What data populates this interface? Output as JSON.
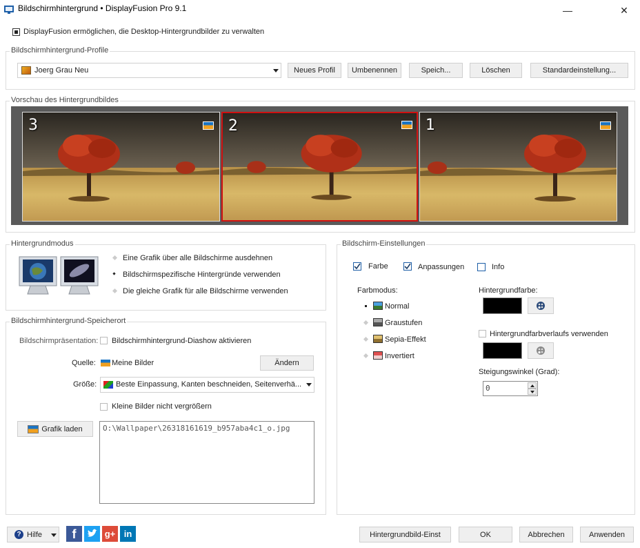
{
  "window": {
    "title": "Bildschirmhintergrund • DisplayFusion Pro 9.1",
    "minimize": "—",
    "close": "✕"
  },
  "enable": {
    "label": "DisplayFusion ermöglichen, die Desktop-Hintergrundbilder zu verwalten",
    "checked": true
  },
  "profiles": {
    "group_label": "Bildschirmhintergrund-Profile",
    "selected": "Joerg Grau Neu",
    "buttons": {
      "new": "Neues Profil",
      "rename": "Umbenennen",
      "save": "Speich...",
      "delete": "Löschen",
      "default": "Standardeinstellung..."
    }
  },
  "preview": {
    "group_label": "Vorschau des Hintergrundbildes",
    "monitors": [
      {
        "number": "3",
        "selected": false
      },
      {
        "number": "2",
        "selected": true
      },
      {
        "number": "1",
        "selected": false
      }
    ]
  },
  "mode": {
    "group_label": "Hintergrundmodus",
    "options": [
      "Eine Grafik über alle Bildschirme ausdehnen",
      "Bildschirmspezifische Hintergründe verwenden",
      "Die gleiche Grafik für alle Bildschirme verwenden"
    ],
    "selected_index": 1
  },
  "location": {
    "group_label": "Bildschirmhintergrund-Speicherort",
    "slideshow_label": "Bildschirmpräsentation:",
    "slideshow_check": "Bildschirmhintergrund-Diashow aktivieren",
    "source_label": "Quelle:",
    "source_value": "Meine Bilder",
    "change_button": "Ändern",
    "size_label": "Größe:",
    "size_value": "Beste Einpassung, Kanten beschneiden, Seitenverhä...",
    "no_enlarge": "Kleine Bilder nicht vergrößern",
    "load_button": "Grafik laden",
    "path": "O:\\Wallpaper\\26318161619_b957aba4c1_o.jpg"
  },
  "screen_settings": {
    "group_label": "Bildschirm-Einstellungen",
    "checks": {
      "color": "Farbe",
      "adjust": "Anpassungen",
      "info": "Info"
    },
    "color_mode_label": "Farbmodus:",
    "color_modes": [
      "Normal",
      "Graustufen",
      "Sepia-Effekt",
      "Invertiert"
    ],
    "bg_color_label": "Hintergrundfarbe:",
    "gradient_label": "Hintergrundfarbverlaufs verwenden",
    "angle_label": "Steigungswinkel (Grad):",
    "angle_value": "0"
  },
  "footer": {
    "help": "Hilfe",
    "wallpaper_settings": "Hintergrundbild-Einst",
    "ok": "OK",
    "cancel": "Abbrechen",
    "apply": "Anwenden"
  },
  "colors": {
    "selection_border": "#d01010",
    "check_blue": "#1c5da6",
    "facebook": "#3b5998",
    "twitter": "#1da1f2",
    "googleplus": "#dd4b39",
    "linkedin": "#0077b5"
  }
}
